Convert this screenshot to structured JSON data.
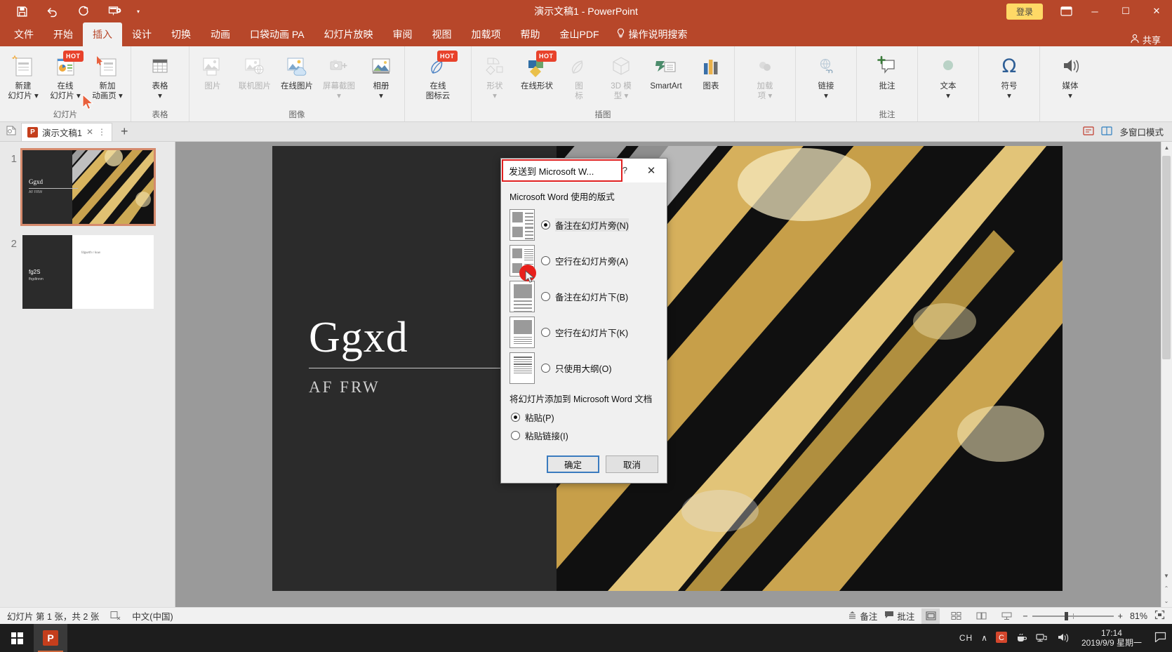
{
  "window": {
    "title": "演示文稿1  -  PowerPoint",
    "signin_label": "登录",
    "minimize": "─",
    "maximize": "☐",
    "close": "✕"
  },
  "quick_access": {
    "save": "save-icon",
    "undo": "undo-icon",
    "redo": "redo-icon",
    "present": "start-slideshow-icon",
    "more": "▾"
  },
  "tabs": [
    {
      "label": "文件",
      "active": false
    },
    {
      "label": "开始",
      "active": false
    },
    {
      "label": "插入",
      "active": true
    },
    {
      "label": "设计",
      "active": false
    },
    {
      "label": "切换",
      "active": false
    },
    {
      "label": "动画",
      "active": false
    },
    {
      "label": "口袋动画 PA",
      "active": false
    },
    {
      "label": "幻灯片放映",
      "active": false
    },
    {
      "label": "审阅",
      "active": false
    },
    {
      "label": "视图",
      "active": false
    },
    {
      "label": "加载项",
      "active": false
    },
    {
      "label": "帮助",
      "active": false
    },
    {
      "label": "金山PDF",
      "active": false
    }
  ],
  "tellme": "操作说明搜索",
  "share": "共享",
  "ribbon": {
    "groups": [
      {
        "name": "幻灯片",
        "items": [
          {
            "label": "新建\n幻灯片 ▾",
            "icon": "new-slide-icon",
            "dim": false,
            "hot": false
          },
          {
            "label": "在线\n幻灯片 ▾",
            "icon": "online-slide-icon",
            "dim": false,
            "hot": true
          },
          {
            "label": "新加\n动画页 ▾",
            "icon": "new-animation-page-icon",
            "dim": false,
            "hot": false
          }
        ]
      },
      {
        "name": "表格",
        "items": [
          {
            "label": "表格\n▾",
            "icon": "table-icon",
            "dim": false,
            "hot": false
          }
        ]
      },
      {
        "name": "图像",
        "items": [
          {
            "label": "图片",
            "icon": "picture-icon",
            "dim": true,
            "hot": false
          },
          {
            "label": "联机图片",
            "icon": "online-picture-icon",
            "dim": true,
            "hot": false
          },
          {
            "label": "在线图片",
            "icon": "cloud-picture-icon",
            "dim": false,
            "hot": false
          },
          {
            "label": "屏幕截图\n▾",
            "icon": "screenshot-icon",
            "dim": true,
            "hot": false
          },
          {
            "label": "相册\n▾",
            "icon": "photo-album-icon",
            "dim": false,
            "hot": false
          }
        ]
      },
      {
        "name": "",
        "items": [
          {
            "label": "在线\n图标云",
            "icon": "online-icon-cloud-icon",
            "dim": false,
            "hot": true
          }
        ]
      },
      {
        "name": "插图",
        "items": [
          {
            "label": "形状\n▾",
            "icon": "shapes-icon",
            "dim": true,
            "hot": false
          },
          {
            "label": "在线形状",
            "icon": "online-shapes-icon",
            "dim": false,
            "hot": true
          },
          {
            "label": "图\n标",
            "icon": "icons-icon",
            "dim": true,
            "hot": false
          },
          {
            "label": "3D 模\n型 ▾",
            "icon": "3d-model-icon",
            "dim": true,
            "hot": false
          },
          {
            "label": "SmartArt",
            "icon": "smartart-icon",
            "dim": false,
            "hot": false
          },
          {
            "label": "图表",
            "icon": "chart-icon",
            "dim": false,
            "hot": false
          }
        ]
      },
      {
        "name": "",
        "items": [
          {
            "label": "加载\n项 ▾",
            "icon": "addins-icon",
            "dim": true,
            "hot": false
          }
        ]
      },
      {
        "name": "",
        "items": [
          {
            "label": "链接\n▾",
            "icon": "link-icon",
            "dim": false,
            "hot": false
          }
        ]
      },
      {
        "name": "批注",
        "items": [
          {
            "label": "批注",
            "icon": "comment-icon",
            "dim": false,
            "hot": false
          }
        ]
      },
      {
        "name": "",
        "items": [
          {
            "label": "文本\n▾",
            "icon": "text-icon",
            "dim": false,
            "hot": false
          }
        ]
      },
      {
        "name": "",
        "items": [
          {
            "label": "符号\n▾",
            "icon": "symbol-icon",
            "dim": false,
            "hot": false
          }
        ]
      },
      {
        "name": "",
        "items": [
          {
            "label": "媒体\n▾",
            "icon": "media-icon",
            "dim": false,
            "hot": false
          }
        ]
      }
    ]
  },
  "doctabbar": {
    "file_name": "演示文稿1",
    "close": "✕",
    "menu": "⋮",
    "new": "+",
    "multiwindow": "多窗口模式"
  },
  "thumbnails": [
    {
      "number": "1",
      "title": "Ggxd",
      "subtitle": "AF FRW",
      "selected": true
    },
    {
      "number": "2",
      "title": "fg2S",
      "subtitle": "fhgdtnnm",
      "body": "fdgwrth r kuw",
      "selected": false
    }
  ],
  "slide": {
    "title": "Ggxd",
    "subtitle": "AF FRW"
  },
  "statusbar": {
    "slide_info": "幻灯片 第 1 张，共 2 张",
    "spell_icon": "spellcheck-icon",
    "language": "中文(中国)",
    "notes": "备注",
    "comments": "批注",
    "view_normal": "normal-view-icon",
    "view_sorter": "slide-sorter-icon",
    "view_reading": "reading-view-icon",
    "view_slideshow": "slideshow-view-icon",
    "zoom_out": "−",
    "zoom_in": "+",
    "zoom_level": "81%",
    "fit_window": "fit-to-window-icon"
  },
  "taskbar": {
    "start": "start-icon",
    "apps": [
      "powerpoint-taskbar-icon"
    ],
    "ime": "CH",
    "tray_up": "∧",
    "tray_icons": [
      "c-app-icon",
      "tea-app-icon",
      "network-icon",
      "volume-icon"
    ],
    "time": "17:14",
    "date": "2019/9/9 星期一",
    "action_center": "action-center-icon"
  },
  "dialog": {
    "title": "发送到 Microsoft W...",
    "help": "?",
    "close": "✕",
    "section_layout": "Microsoft Word 使用的版式",
    "layout_options": [
      {
        "label": "备注在幻灯片旁(N)",
        "selected": true,
        "thumb": "notes-next-to-slides"
      },
      {
        "label": "空行在幻灯片旁(A)",
        "selected": false,
        "thumb": "blank-lines-next-to-slides"
      },
      {
        "label": "备注在幻灯片下(B)",
        "selected": false,
        "thumb": "notes-below-slides"
      },
      {
        "label": "空行在幻灯片下(K)",
        "selected": false,
        "thumb": "blank-lines-below-slides"
      },
      {
        "label": "只使用大纲(O)",
        "selected": false,
        "thumb": "outline-only"
      }
    ],
    "section_paste": "将幻灯片添加到 Microsoft Word 文档",
    "paste_options": [
      {
        "label": "粘贴(P)",
        "selected": true
      },
      {
        "label": "粘贴链接(I)",
        "selected": false
      }
    ],
    "ok": "确定",
    "cancel": "取消"
  },
  "colors": {
    "accent": "#b7472a",
    "highlight_box": "#e02020",
    "cursor_blob": "#e8201b",
    "signin_bg": "#ffd966"
  }
}
